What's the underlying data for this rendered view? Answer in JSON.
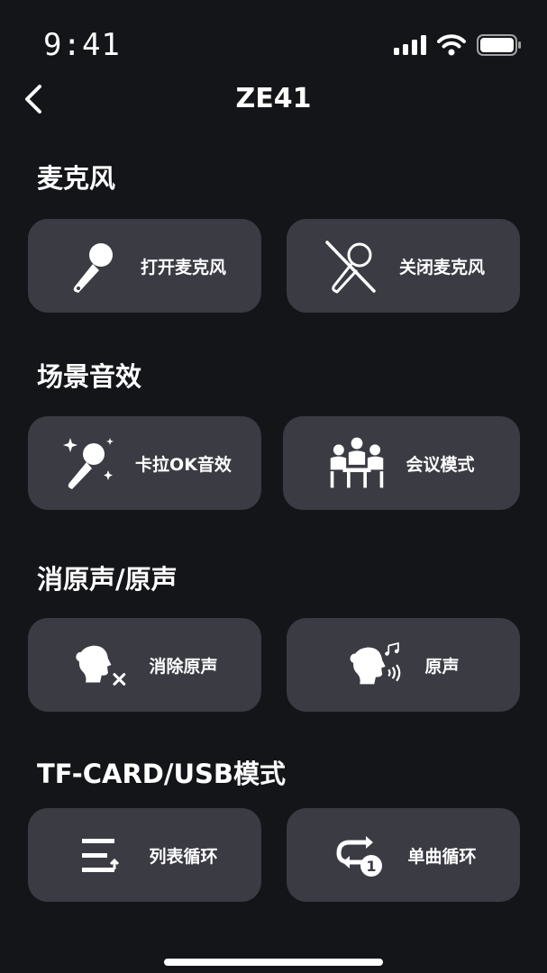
{
  "status_bar": {
    "time": "9:41"
  },
  "nav": {
    "title": "ZE41"
  },
  "sections": [
    {
      "title": "麦克风",
      "buttons": [
        {
          "label": "打开麦克风",
          "icon": "microphone-icon"
        },
        {
          "label": "关闭麦克风",
          "icon": "microphone-off-icon"
        }
      ]
    },
    {
      "title": "场景音效",
      "buttons": [
        {
          "label": "卡拉OK音效",
          "icon": "karaoke-sparkle-mic-icon"
        },
        {
          "label": "会议模式",
          "icon": "meeting-people-icon"
        }
      ]
    },
    {
      "title": "消原声/原声",
      "buttons": [
        {
          "label": "消除原声",
          "icon": "vocal-remove-icon"
        },
        {
          "label": "原声",
          "icon": "vocal-original-icon"
        }
      ]
    },
    {
      "title": "TF-CARD/USB模式",
      "buttons": [
        {
          "label": "列表循环",
          "icon": "list-loop-icon"
        },
        {
          "label": "单曲循环",
          "icon": "single-loop-icon"
        }
      ]
    }
  ],
  "colors": {
    "background": "#141519",
    "card": "#3a3b43",
    "text": "#ffffff"
  }
}
